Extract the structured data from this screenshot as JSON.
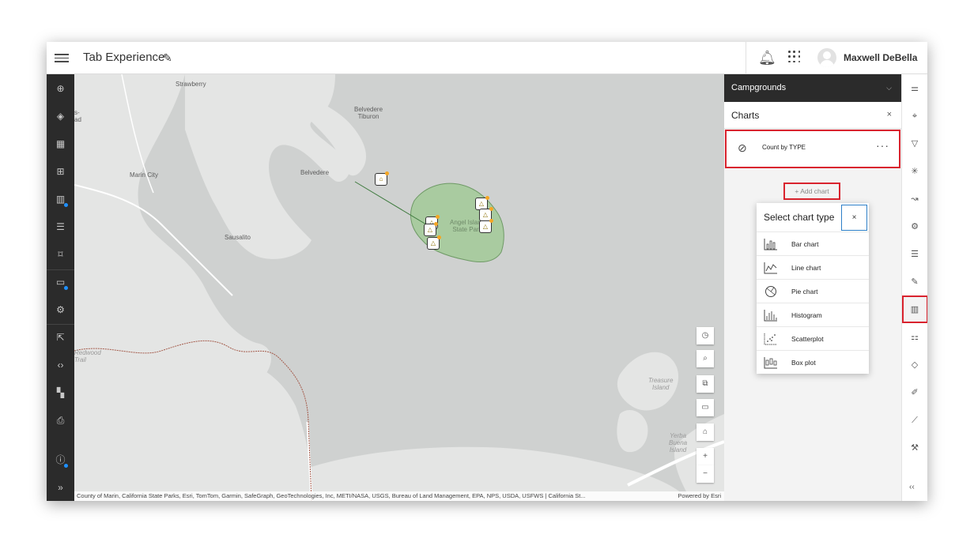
{
  "header": {
    "title": "Tab Experience",
    "user_name": "Maxwell DeBella",
    "icons": [
      "menu-icon",
      "pencil-icon",
      "bell-icon",
      "app-launcher-icon",
      "avatar"
    ]
  },
  "left_toolbar": {
    "icons": [
      "add-icon",
      "layers-icon",
      "table-icon",
      "qr-icon",
      "chart-icon",
      "list-icon",
      "bookmark-icon",
      "card-icon",
      "gear-icon",
      "share-icon",
      "code-icon",
      "widgets-icon",
      "print-icon",
      "info-icon",
      "expand-icon"
    ]
  },
  "map": {
    "labels": {
      "strawberry": "Strawberry",
      "belvedere_tiburon": "Belvedere\nTiburon",
      "marin_city": "Marin City",
      "belvedere": "Belvedere",
      "sausalito": "Sausalito",
      "angel_island": "Angel Island\nState Park",
      "treasure_island": "Treasure\nIsland",
      "yerba_buena": "Yerba\nBuena\nIsland",
      "left_edge_top": "s-\nad",
      "left_edge_mid": "Redwood\nTrail"
    },
    "attribution": "County of Marin, California State Parks, Esri, TomTom, Garmin, SafeGraph, GeoTechnologies, Inc, METI/NASA, USGS, Bureau of Land Management, EPA, NPS, USDA, USFWS | California St...",
    "powered_by": "Powered by Esri",
    "tools": {
      "zoom_in": "+",
      "zoom_out": "−"
    }
  },
  "panel": {
    "layer_name": "Campgrounds",
    "section_title": "Charts",
    "close": "×",
    "chart_item": {
      "name": "Count by TYPE",
      "more": "···"
    },
    "add_chart": "+ Add chart"
  },
  "chart_type_menu": {
    "title": "Select chart type",
    "close": "×",
    "options": [
      {
        "label": "Bar chart",
        "icon": "bar-chart-icon"
      },
      {
        "label": "Line chart",
        "icon": "line-chart-icon"
      },
      {
        "label": "Pie chart",
        "icon": "pie-chart-icon"
      },
      {
        "label": "Histogram",
        "icon": "histogram-icon"
      },
      {
        "label": "Scatterplot",
        "icon": "scatterplot-icon"
      },
      {
        "label": "Box plot",
        "icon": "box-plot-icon"
      }
    ]
  },
  "right_toolbar": {
    "collapse": "‹‹",
    "icons": [
      "sliders-icon",
      "map-search-icon",
      "filter-icon",
      "sparkle-icon",
      "route-icon",
      "settings-cog-icon",
      "align-icon",
      "edit-pen-icon",
      "chart-settings-icon",
      "analysis-icon",
      "layers-stack-icon",
      "edit-box-icon",
      "measure-icon",
      "wrench-icon"
    ]
  }
}
